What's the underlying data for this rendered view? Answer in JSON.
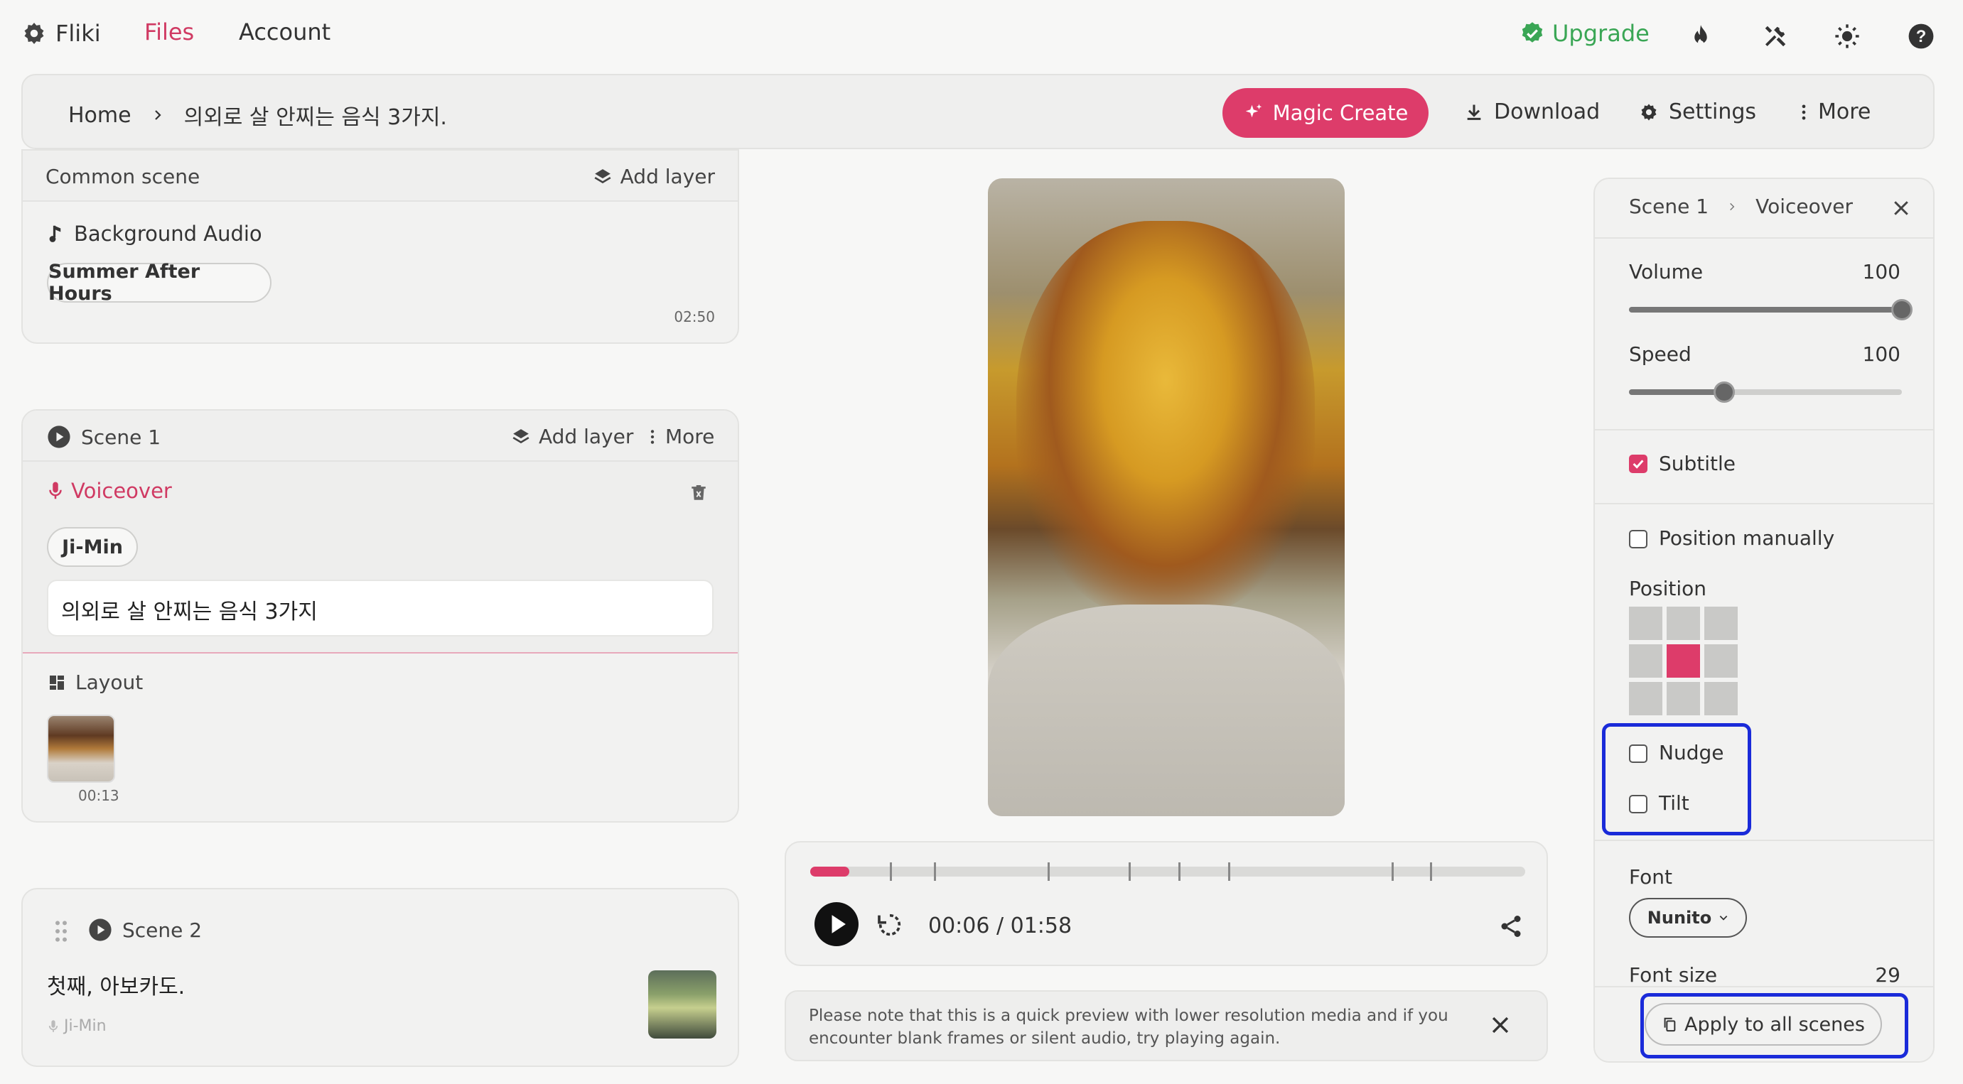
{
  "nav": {
    "brand": "Fliki",
    "files": "Files",
    "account": "Account",
    "upgrade": "Upgrade"
  },
  "header": {
    "home": "Home",
    "title": "의외로 살 안찌는 음식 3가지.",
    "magic_create": "Magic Create",
    "download": "Download",
    "settings": "Settings",
    "more": "More"
  },
  "common_scene": {
    "title": "Common scene",
    "add_layer": "Add layer",
    "bg_audio_label": "Background Audio",
    "track": "Summer After Hours",
    "duration": "02:50"
  },
  "scene1": {
    "title": "Scene 1",
    "add_layer": "Add layer",
    "more": "More",
    "voiceover_label": "Voiceover",
    "voice": "Ji-Min",
    "text": "의외로 살 안찌는 음식 3가지",
    "layout_label": "Layout",
    "layout_duration": "00:13"
  },
  "scene2": {
    "title": "Scene 2",
    "text": "첫째, 아보카도.",
    "voice": "Ji-Min"
  },
  "player": {
    "time": "00:06 / 01:58",
    "progress": 0.055,
    "notice": "Please note that this is a quick preview with lower resolution media and if you encounter blank frames or silent audio, try playing again."
  },
  "panel": {
    "crumb_scene": "Scene 1",
    "crumb_item": "Voiceover",
    "volume_label": "Volume",
    "volume_value": "100",
    "volume_level": 1.0,
    "speed_label": "Speed",
    "speed_value": "100",
    "speed_level": 0.35,
    "subtitle_label": "Subtitle",
    "subtitle_checked": true,
    "position_manually_label": "Position manually",
    "position_label": "Position",
    "position_selected": "middle-center",
    "nudge_label": "Nudge",
    "tilt_label": "Tilt",
    "font_label": "Font",
    "font_value": "Nunito",
    "font_size_label": "Font size",
    "font_size_value": "29",
    "apply_all": "Apply to all scenes"
  },
  "colors": {
    "accent": "#dd3c6a",
    "highlight": "#1a2bd9",
    "upgrade_green": "#3aa655"
  }
}
